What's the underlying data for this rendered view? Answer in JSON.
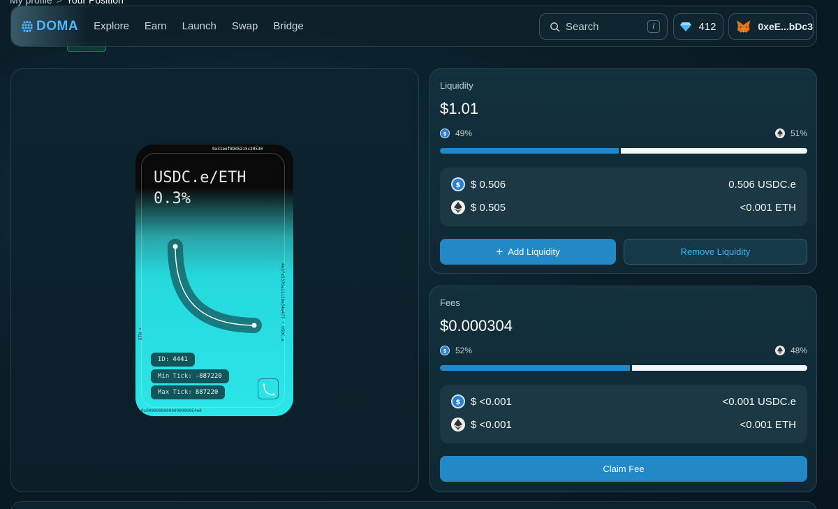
{
  "breadcrumb": {
    "parent": "My profile",
    "separator": ">",
    "current": "Your Position"
  },
  "nav": {
    "logo": "DOMA",
    "links": [
      "Explore",
      "Earn",
      "Launch",
      "Swap",
      "Bridge"
    ],
    "search_label": "Search",
    "search_shortcut": "/",
    "points": "412",
    "wallet": "0xeE...bDc3"
  },
  "nft": {
    "pair": "USDC.e/ETH",
    "fee_tier": "0.3%",
    "edge_top": "0x31eef89d5215c20530",
    "edge_right": "4e2fe5376a1113be54e477 • USDC.e",
    "edge_left": "ETH •",
    "edge_bottom": "0x000000000000000000E4e0",
    "id_label": "ID:",
    "id_value": "4441",
    "min_tick_label": "Min Tick:",
    "min_tick_value": "-887220",
    "max_tick_label": "Max Tick:",
    "max_tick_value": "887220"
  },
  "liquidity": {
    "label": "Liquidity",
    "amount": "$1.01",
    "usdc_pct": "49%",
    "eth_pct": "51%",
    "usdc_fraction": 0.49,
    "usdc_usd": "$ 0.506",
    "usdc_amount": "0.506 USDC.e",
    "eth_usd": "$ 0.505",
    "eth_amount": "<0.001 ETH",
    "add_button": "Add Liquidity",
    "remove_button": "Remove Liquidity"
  },
  "fees": {
    "label": "Fees",
    "amount": "$0.000304",
    "usdc_pct": "52%",
    "eth_pct": "48%",
    "usdc_fraction": 0.52,
    "usdc_usd": "$ <0.001",
    "usdc_amount": "<0.001 USDC.e",
    "eth_usd": "$ <0.001",
    "eth_amount": "<0.001 ETH",
    "claim_button": "Claim Fee"
  },
  "colors": {
    "accent": "#2389c6",
    "logo": "#4ab7ff",
    "bar_fill": "#f4f7f9"
  }
}
